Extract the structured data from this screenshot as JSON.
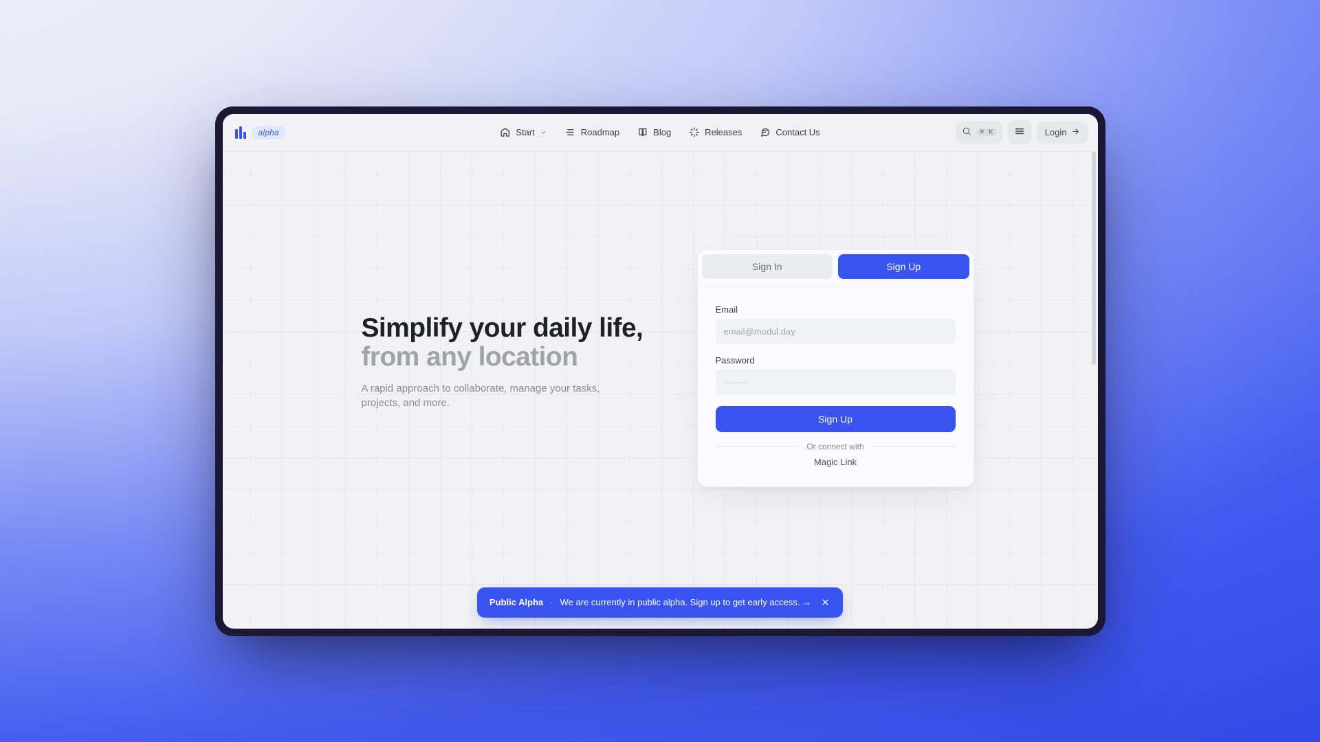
{
  "brand": {
    "alpha_chip": "alpha"
  },
  "nav": {
    "items": [
      {
        "label": "Start",
        "icon": "home-icon",
        "has_chevron": true
      },
      {
        "label": "Roadmap",
        "icon": "list-icon"
      },
      {
        "label": "Blog",
        "icon": "book-icon"
      },
      {
        "label": "Releases",
        "icon": "sparkle-icon"
      },
      {
        "label": "Contact Us",
        "icon": "chat-icon"
      }
    ],
    "search_shortcut": "⌘ K",
    "login_label": "Login"
  },
  "hero": {
    "headline_main": "Simplify your daily life,",
    "headline_sub": "from any location",
    "subtext": "A rapid approach to collaborate, manage your tasks, projects, and more."
  },
  "auth": {
    "tab_signin": "Sign In",
    "tab_signup": "Sign Up",
    "active_tab": "signup",
    "email_label": "Email",
    "email_placeholder": "email@modul.day",
    "password_label": "Password",
    "password_placeholder": "········",
    "submit_label": "Sign Up",
    "connect_divider": "Or connect with",
    "magic_link_label": "Magic Link"
  },
  "banner": {
    "title": "Public Alpha",
    "separator": "·",
    "text": "We are currently in public alpha. Sign up to get early access. →"
  },
  "colors": {
    "primary": "#3853ef",
    "bg": "#f2f2f4"
  }
}
